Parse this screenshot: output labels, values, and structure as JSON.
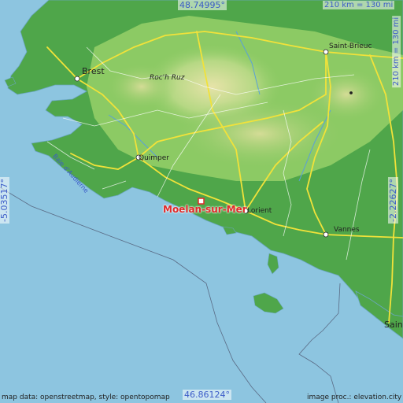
{
  "map": {
    "coords": {
      "top_lat": "48.74995°",
      "bottom_lat": "46.86124°",
      "left_lon": "-5.03517°",
      "right_lon": "-2.22627°"
    },
    "scale": {
      "top": "210 km = 130 mi",
      "right": "210 km = 130 mi"
    },
    "highlight_place": "Moelan-sur-Mer",
    "places": {
      "brest": "Brest",
      "saint_brieuc": "Saint-Brieuc",
      "roc_h_ruz": "Roc'h Ruz",
      "quimper": "Quimper",
      "baie": "Baie d'Audierne",
      "lorient": "Lorient",
      "vannes": "Vannes",
      "saint_edge": "Saint"
    },
    "attribution": {
      "left": "map data: openstreetmap, style: opentopomap",
      "right": "image proc.: elevation.city"
    },
    "colors": {
      "sea": "#8dc5e0",
      "lowland": "#3f9a3f",
      "midland": "#8cca64",
      "upland": "#d7dc98",
      "road": "#f1e23a",
      "highlight": "#e02a2a",
      "label_blue": "#3b5bc8"
    }
  }
}
